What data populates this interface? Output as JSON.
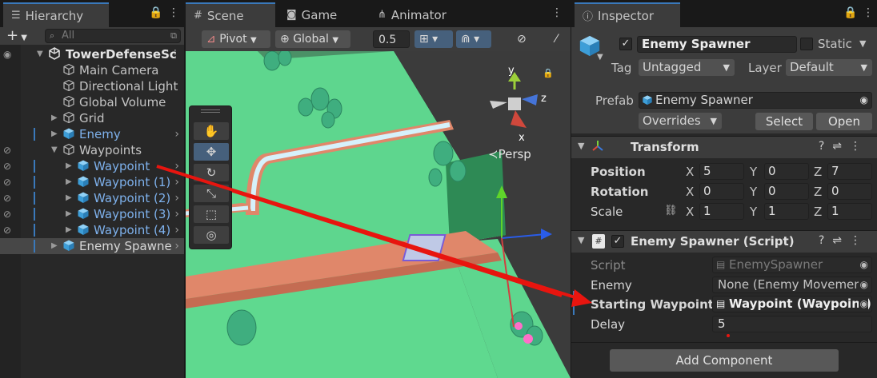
{
  "hierarchy": {
    "tab": "Hierarchy",
    "add_label": "+",
    "search_placeholder": "All",
    "rows": [
      {
        "label": "TowerDefenseSc",
        "depth": 0
      },
      {
        "label": "Main Camera",
        "depth": 1
      },
      {
        "label": "Directional Light",
        "depth": 1
      },
      {
        "label": "Global Volume",
        "depth": 1
      },
      {
        "label": "Grid",
        "depth": 1
      },
      {
        "label": "Enemy",
        "depth": 1
      },
      {
        "label": "Waypoints",
        "depth": 1
      },
      {
        "label": "Waypoint",
        "depth": 2
      },
      {
        "label": "Waypoint (1)",
        "depth": 2
      },
      {
        "label": "Waypoint (2)",
        "depth": 2
      },
      {
        "label": "Waypoint (3)",
        "depth": 2
      },
      {
        "label": "Waypoint (4)",
        "depth": 2
      },
      {
        "label": "Enemy Spawne",
        "depth": 1
      }
    ]
  },
  "scene": {
    "tabs": [
      "Scene",
      "Game",
      "Animator"
    ],
    "toolbar": {
      "pivot": "Pivot",
      "global": "Global",
      "snap_value": "0.5"
    },
    "gizmo": {
      "x": "x",
      "y": "y",
      "z": "z",
      "persp": "Persp"
    }
  },
  "inspector": {
    "tab": "Inspector",
    "object_name": "Enemy Spawner",
    "static_label": "Static",
    "tag_label": "Tag",
    "tag_value": "Untagged",
    "layer_label": "Layer",
    "layer_value": "Default",
    "prefab_label": "Prefab",
    "prefab_value": "Enemy Spawner",
    "overrides": "Overrides",
    "select": "Select",
    "open": "Open",
    "transform": {
      "title": "Transform",
      "position_label": "Position",
      "rotation_label": "Rotation",
      "scale_label": "Scale",
      "x": "X",
      "y": "Y",
      "z": "Z",
      "position": [
        "5",
        "0",
        "7"
      ],
      "rotation": [
        "0",
        "0",
        "0"
      ],
      "scale": [
        "1",
        "1",
        "1"
      ]
    },
    "script_comp": {
      "title": "Enemy Spawner (Script)",
      "script_label": "Script",
      "script_value": "EnemySpawner",
      "enemy_label": "Enemy",
      "enemy_value": "None (Enemy Movemen",
      "waypoint_label": "Starting Waypoint",
      "waypoint_value": "Waypoint (Waypoint)",
      "delay_label": "Delay",
      "delay_value": "5"
    },
    "add_component": "Add Component"
  },
  "colors": {
    "accent": "#3a79bb",
    "prefab_text": "#7eb1ec",
    "ground": "#5ed68e",
    "path": "#e0876a",
    "arrow": "#e8150f"
  }
}
